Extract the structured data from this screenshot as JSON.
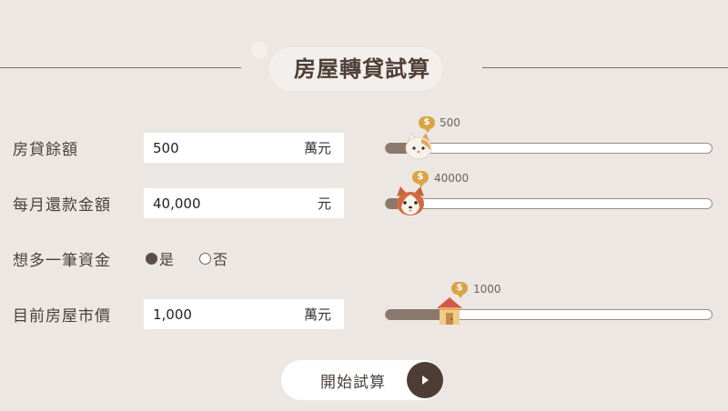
{
  "header": {
    "title": "房屋轉貸試算"
  },
  "form": {
    "loan_balance": {
      "label": "房貸餘額",
      "value": "500",
      "unit": "萬元"
    },
    "monthly_payment": {
      "label": "每月還款金額",
      "value": "40,000",
      "unit": "元"
    },
    "extra_cash": {
      "label": "想多一筆資金",
      "options": [
        "是",
        "否"
      ],
      "selected": "是"
    },
    "house_value": {
      "label": "目前房屋市價",
      "value": "1,000",
      "unit": "萬元"
    }
  },
  "sliders": {
    "loan_balance": {
      "value_label": "500",
      "coin_icon": "$",
      "thumb_icon": "cat-face-icon",
      "fill_fraction": 0.07
    },
    "monthly_payment": {
      "value_label": "40000",
      "coin_icon": "$",
      "thumb_icon": "dog-face-icon",
      "fill_fraction": 0.04
    },
    "house_value": {
      "value_label": "1000",
      "coin_icon": "$",
      "thumb_icon": "house-icon",
      "fill_fraction": 0.2
    }
  },
  "submit": {
    "label": "開始試算",
    "icon": "play-icon"
  },
  "colors": {
    "background": "#ece7e3",
    "accent": "#4e3d35",
    "slider_fill": "#8a786c",
    "coin": "#d9a445"
  }
}
